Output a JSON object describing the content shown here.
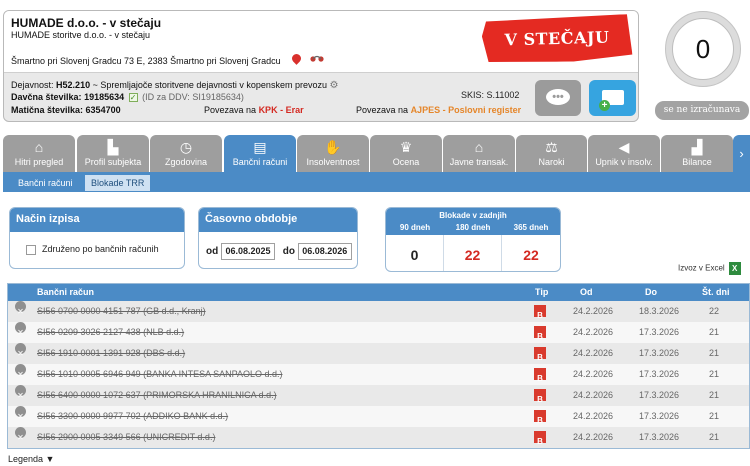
{
  "company": {
    "name": "HUMADE d.o.o. - v stečaju",
    "subname": "HUMADE storitve d.o.o. - v stečaju",
    "address": "Šmartno pri Slovenj Gradcu 73 E, 2383 Šmartno pri Slovenj Gradcu",
    "stamp": "V STEČAJU",
    "activity_label": "Dejavnost:",
    "activity_code": "H52.210",
    "activity_text": "~ Spremljajoče storitvene dejavnosti v kopenskem prevozu",
    "tax_label": "Davčna številka:",
    "tax_number": "19185634",
    "vat_text": "(ID za DDV: SI19185634)",
    "reg_label": "Matična številka:",
    "reg_number": "6354700",
    "link1_prefix": "Povezava na",
    "link1_label": "KPK - Erar",
    "link2_prefix": "Povezava na",
    "link2_label": "AJPES - Poslovni register",
    "skis_label": "SKIS:",
    "skis_value": "S.11002"
  },
  "score": {
    "value": "0",
    "note": "se ne izračunava"
  },
  "tabs": [
    {
      "label": "Hitri pregled",
      "icon": "home-icon"
    },
    {
      "label": "Profil subjekta",
      "icon": "factory-icon"
    },
    {
      "label": "Zgodovina",
      "icon": "clock-icon"
    },
    {
      "label": "Bančni računi",
      "icon": "card-icon"
    },
    {
      "label": "Insolventnost",
      "icon": "handshake-icon"
    },
    {
      "label": "Ocena",
      "icon": "trophy-icon"
    },
    {
      "label": "Javne transak.",
      "icon": "bank-icon"
    },
    {
      "label": "Naroki",
      "icon": "scales-icon"
    },
    {
      "label": "Upnik v insolv.",
      "icon": "megaphone-icon"
    },
    {
      "label": "Bilance",
      "icon": "chart-icon"
    }
  ],
  "subtabs": [
    "Bančni računi",
    "Blokade TRR"
  ],
  "filters": {
    "mode_title": "Način izpisa",
    "mode_option": "Združeno po bančnih računih",
    "period_title": "Časovno obdobje",
    "from_label": "od",
    "from_value": "06.08.2025",
    "to_label": "do",
    "to_value": "06.08.2026"
  },
  "blocks": {
    "title": "Blokade v zadnjih",
    "cols": [
      "90 dneh",
      "180 dneh",
      "365 dneh"
    ],
    "values": [
      "0",
      "22",
      "22"
    ],
    "colors": [
      "#222222",
      "#d42a22",
      "#d42a22"
    ]
  },
  "excel_label": "Izvoz v Excel",
  "table": {
    "headers": [
      "Bančni račun",
      "Tip",
      "Od",
      "Do",
      "Št. dni"
    ],
    "rows": [
      {
        "account": "SI56 0700 0000 4151 787 (GB d.d., Kranj)",
        "type": "B",
        "from": "24.2.2026",
        "to": "18.3.2026",
        "days": "22"
      },
      {
        "account": "SI56 0209 3026 2127 438 (NLB d.d.)",
        "type": "B",
        "from": "24.2.2026",
        "to": "17.3.2026",
        "days": "21"
      },
      {
        "account": "SI56 1910 0001 1391 928 (DBS d.d.)",
        "type": "B",
        "from": "24.2.2026",
        "to": "17.3.2026",
        "days": "21"
      },
      {
        "account": "SI56 1010 0005 6946 949 (BANKA INTESA SANPAOLO d.d.)",
        "type": "B",
        "from": "24.2.2026",
        "to": "17.3.2026",
        "days": "21"
      },
      {
        "account": "SI56 6400 0000 1072 637 (PRIMORSKA HRANILNICA d.d.)",
        "type": "B",
        "from": "24.2.2026",
        "to": "17.3.2026",
        "days": "21"
      },
      {
        "account": "SI56 3300 0000 9977 702 (ADDIKO BANK d.d.)",
        "type": "B",
        "from": "24.2.2026",
        "to": "17.3.2026",
        "days": "21"
      },
      {
        "account": "SI56 2900 0005 3349 566 (UNICREDIT d.d.)",
        "type": "B",
        "from": "24.2.2026",
        "to": "17.3.2026",
        "days": "21"
      }
    ]
  },
  "legend_label": "Legenda ▼"
}
